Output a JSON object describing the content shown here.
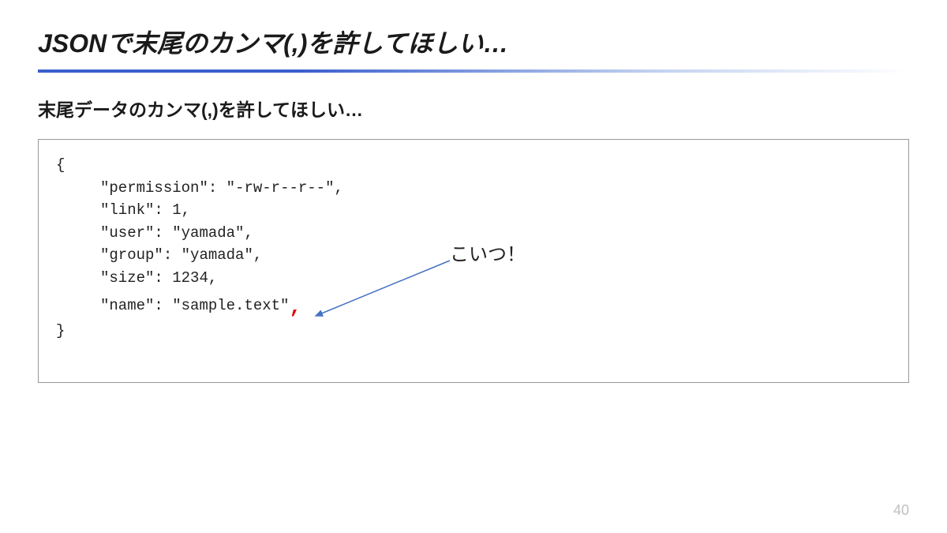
{
  "slide": {
    "title": "JSONで末尾のカンマ(,)を許してほしい…",
    "subtitle": "末尾データのカンマ(,)を許してほしい…",
    "code": {
      "open": "{",
      "lines": [
        {
          "key": "permission",
          "value": "\"-rw-r--r--\"",
          "comma": ","
        },
        {
          "key": "link",
          "value": "1",
          "comma": ","
        },
        {
          "key": "user",
          "value": "\"yamada\"",
          "comma": ","
        },
        {
          "key": "group",
          "value": "\"yamada\"",
          "comma": ","
        },
        {
          "key": "size",
          "value": "1234",
          "comma": ","
        },
        {
          "key": "name",
          "value": "\"sample.text\"",
          "trailing": ","
        }
      ],
      "close": "}"
    },
    "annotation": "こいつ！",
    "pageNumber": "40"
  }
}
